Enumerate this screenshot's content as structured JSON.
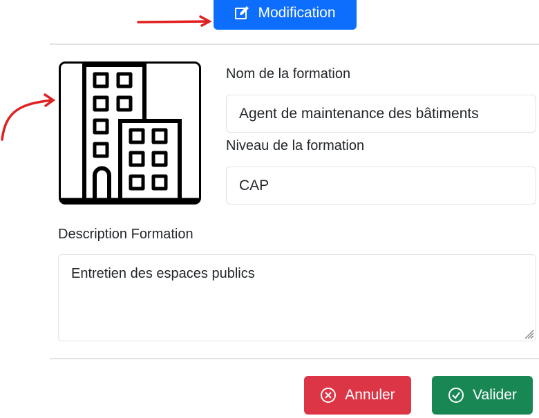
{
  "header": {
    "modify_label": "Modification",
    "modify_color": "#0d6efd"
  },
  "form": {
    "name_label": "Nom de la formation",
    "name_value": "Agent de maintenance des bâtiments",
    "level_label": "Niveau de la formation",
    "level_value": "CAP",
    "description_label": "Description Formation",
    "description_value": "Entretien des espaces publics",
    "image_icon": "building-icon"
  },
  "footer": {
    "cancel_label": "Annuler",
    "cancel_color": "#dc3545",
    "submit_label": "Valider",
    "submit_color": "#198754"
  },
  "annotations": {
    "color": "#e02020"
  }
}
